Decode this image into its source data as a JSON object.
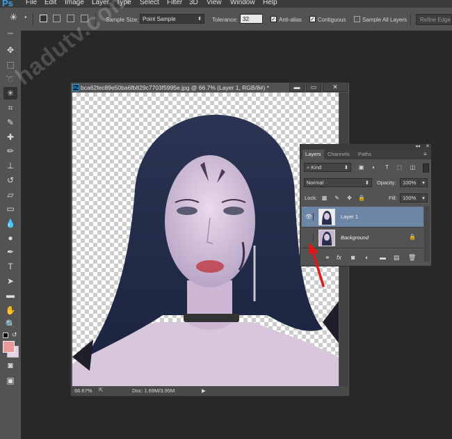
{
  "app": {
    "logo": "Ps"
  },
  "menu": [
    "File",
    "Edit",
    "Image",
    "Layer",
    "Type",
    "Select",
    "Filter",
    "3D",
    "View",
    "Window",
    "Help"
  ],
  "options": {
    "sample_size_label": "Sample Size:",
    "sample_size_value": "Point Sample",
    "tolerance_label": "Tolerance:",
    "tolerance_value": "32",
    "anti_alias_label": "Anti-alias",
    "anti_alias_checked": true,
    "contiguous_label": "Contiguous",
    "contiguous_checked": true,
    "sample_all_layers_label": "Sample All Layers",
    "sample_all_layers_checked": false,
    "refine_edge_label": "Refine Edge"
  },
  "document": {
    "title": "bca62fec89e50ba6fb829c7703f5995e.jpg @ 66.7% (Layer 1, RGB/8#) *",
    "zoom": "66.67%",
    "doc_info": "Doc: 1.69M/3.95M",
    "window_buttons": {
      "minimize": "▬",
      "restore": "▭",
      "close": "✕"
    }
  },
  "layers_panel": {
    "tabs": [
      "Layers",
      "Channels",
      "Paths"
    ],
    "active_tab": "Layers",
    "kind_label": "Kind",
    "blend_mode": "Normal",
    "opacity_label": "Opacity:",
    "opacity_value": "100%",
    "lock_label": "Lock:",
    "fill_label": "Fill:",
    "fill_value": "100%",
    "layers": [
      {
        "name": "Layer 1",
        "visible": true,
        "selected": true
      },
      {
        "name": "Background",
        "visible": false,
        "selected": false,
        "locked": true
      }
    ]
  },
  "watermark": "hadutv.com",
  "colors": {
    "foreground": "#e89a9a",
    "background": "#e8d0e8",
    "selected_layer": "#6d86a6",
    "annotation_arrow": "#e01818"
  }
}
